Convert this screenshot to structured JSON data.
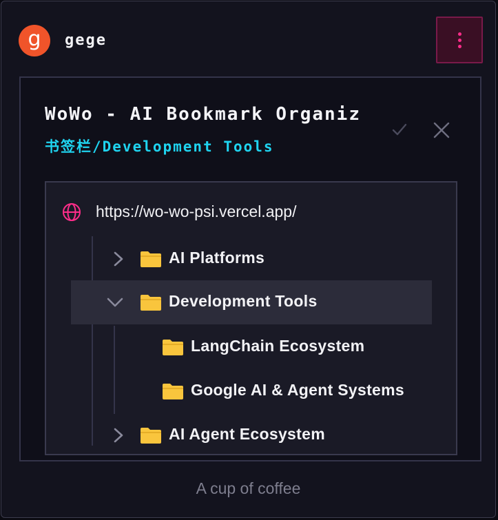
{
  "user": {
    "avatar_letter": "g",
    "name": "gege"
  },
  "icons": {
    "menu": "vertical-dots-icon",
    "confirm": "check-icon",
    "close": "close-icon",
    "url": "globe-icon",
    "folder": "folder-icon",
    "collapsed": "chevron-right-icon",
    "expanded": "chevron-down-icon"
  },
  "colors": {
    "avatar": "#f0542a",
    "accent_pink": "#ff2d8a",
    "path_cyan": "#1fd4f0",
    "folder_yellow": "#f9c53d"
  },
  "panel": {
    "title": "WoWo - AI Bookmark Organiz",
    "path": "书签栏/Development Tools",
    "url": "https://wo-wo-psi.vercel.app/"
  },
  "tree": [
    {
      "label": "AI Platforms",
      "expanded": false,
      "level": 0
    },
    {
      "label": "Development Tools",
      "expanded": true,
      "level": 0,
      "selected": true
    },
    {
      "label": "LangChain Ecosystem",
      "level": 1
    },
    {
      "label": "Google AI & Agent Systems",
      "level": 1
    },
    {
      "label": "AI Agent Ecosystem",
      "expanded": false,
      "level": 0
    }
  ],
  "footer": {
    "text": "A cup of coffee"
  }
}
